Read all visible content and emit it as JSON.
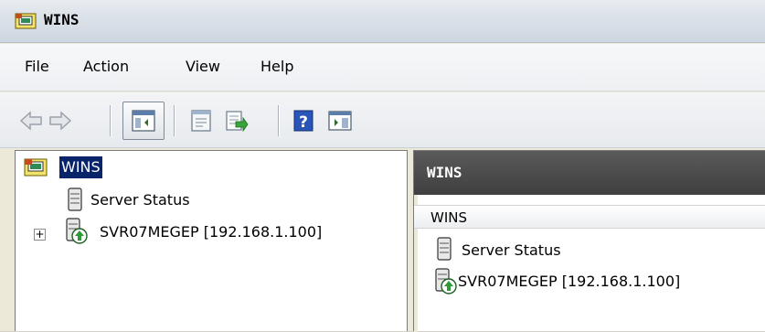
{
  "window": {
    "title": "WINS"
  },
  "menu": {
    "items": [
      {
        "label": "File"
      },
      {
        "label": "Action"
      },
      {
        "label": "View"
      },
      {
        "label": "Help"
      }
    ]
  },
  "toolbar": {
    "buttons": [
      {
        "icon": "back-arrow-icon"
      },
      {
        "icon": "forward-arrow-icon"
      },
      {
        "icon": "show-hide-console-tree-icon",
        "pressed": true
      },
      {
        "icon": "properties-icon"
      },
      {
        "icon": "export-list-icon"
      },
      {
        "icon": "help-icon"
      },
      {
        "icon": "show-hide-action-pane-icon"
      }
    ]
  },
  "tree": {
    "root": {
      "label": "WINS",
      "selected": true,
      "icon": "wins-console-icon"
    },
    "children": [
      {
        "label": "Server Status",
        "icon": "server-status-icon"
      },
      {
        "label": "SVR07MEGEP [192.168.1.100]",
        "icon": "wins-server-icon",
        "expander": "+"
      }
    ]
  },
  "details": {
    "header": "WINS",
    "column": "WINS",
    "rows": [
      {
        "label": "Server Status",
        "icon": "server-status-icon"
      },
      {
        "label": "SVR07MEGEP [192.168.1.100]",
        "icon": "wins-server-icon"
      }
    ]
  },
  "colors": {
    "selection": "#0a246a",
    "header_bg": "#4a4a4a",
    "titlebar": "#dde3ea"
  }
}
